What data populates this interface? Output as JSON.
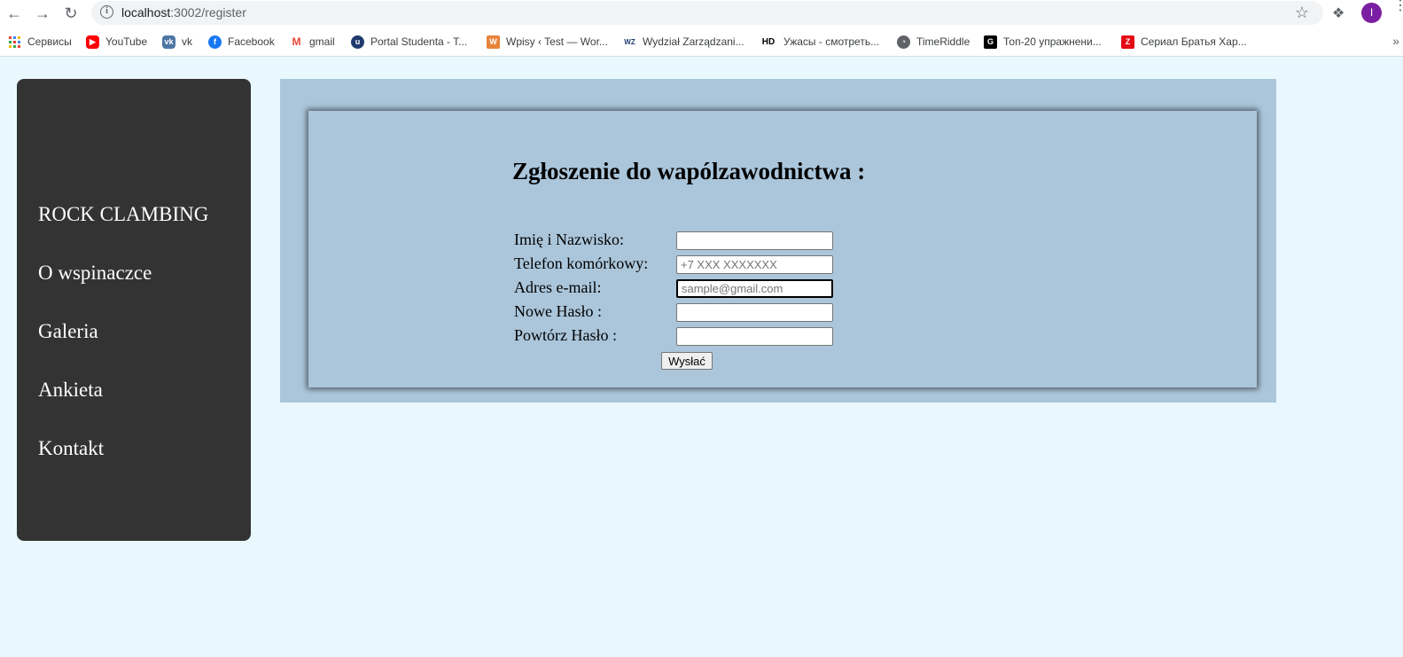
{
  "browser": {
    "url_host": "localhost",
    "url_path": ":3002/register",
    "profile_initial": "I",
    "bookmarks": [
      {
        "label": "Сервисы",
        "icon": "apps-grid-icon"
      },
      {
        "label": "YouTube",
        "icon": "youtube-icon"
      },
      {
        "label": "vk",
        "icon": "vk-icon"
      },
      {
        "label": "Facebook",
        "icon": "facebook-icon"
      },
      {
        "label": "gmail",
        "icon": "gmail-icon"
      },
      {
        "label": "Portal Studenta - T...",
        "icon": "portal-icon"
      },
      {
        "label": "Wpisy ‹ Test — Wor...",
        "icon": "wordpress-icon"
      },
      {
        "label": "Wydział Zarządzani...",
        "icon": "wz-icon"
      },
      {
        "label": "Ужасы - смотреть...",
        "icon": "hd-icon",
        "icon_text": "HD"
      },
      {
        "label": "TimeRiddle",
        "icon": "timeriddle-icon"
      },
      {
        "label": "Топ-20 упражнени...",
        "icon": "gl-icon"
      },
      {
        "label": "Сериал Братья Хар...",
        "icon": "z-icon"
      }
    ]
  },
  "sidebar": {
    "items": [
      {
        "label": "ROCK CLAMBING"
      },
      {
        "label": "O wspinaczce"
      },
      {
        "label": "Galeria"
      },
      {
        "label": "Ankieta"
      },
      {
        "label": "Kontakt"
      }
    ]
  },
  "form": {
    "title": "Zgłoszenie do wapólzawodnictwa :",
    "fields": [
      {
        "label": "Imię i Nazwisko:",
        "placeholder": "",
        "value": ""
      },
      {
        "label": "Telefon komórkowy:",
        "placeholder": "+7 XXX XXXXXXX",
        "value": ""
      },
      {
        "label": "Adres e-mail:",
        "placeholder": "sample@gmail.com",
        "value": ""
      },
      {
        "label": "Nowe Hasło :",
        "placeholder": "",
        "value": ""
      },
      {
        "label": "Powtórz Hasło :",
        "placeholder": "",
        "value": ""
      }
    ],
    "submit_label": "Wysłać"
  },
  "colors": {
    "page_bg": "#e8f8fe",
    "sidebar_bg": "#333333",
    "panel_bg": "#abc6db"
  }
}
